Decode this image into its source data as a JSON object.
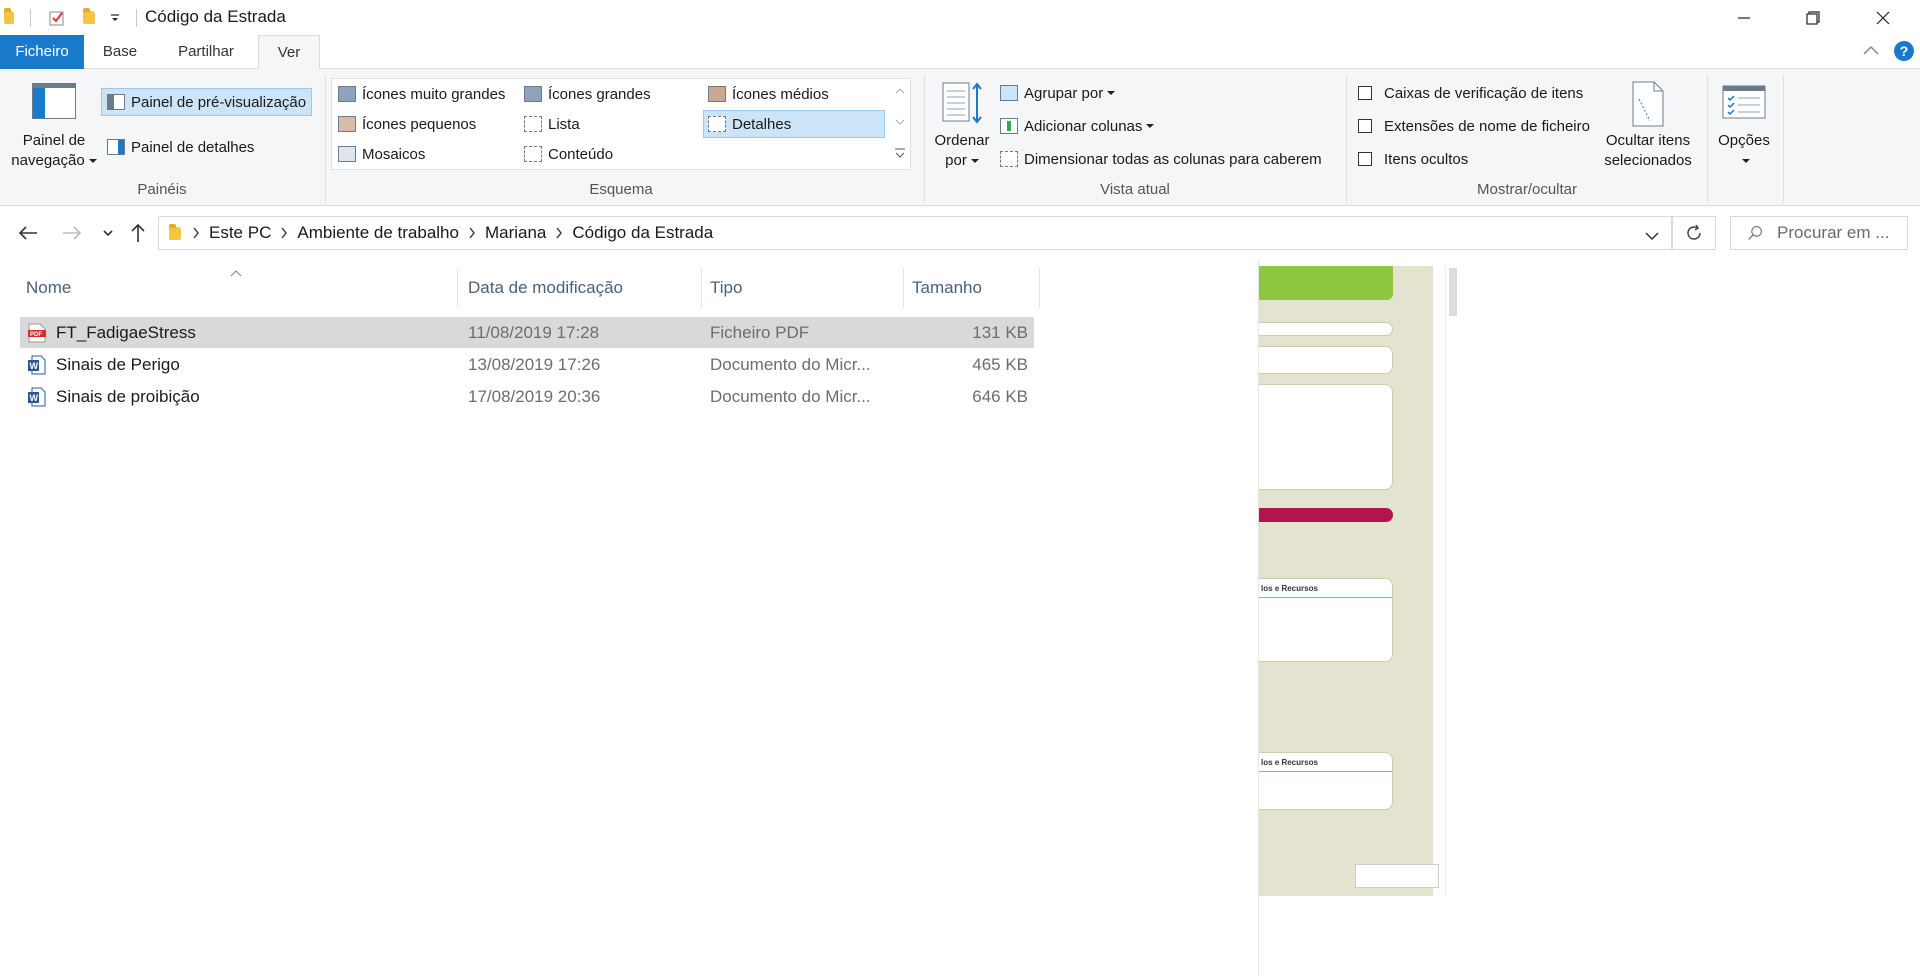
{
  "window": {
    "title": "Código da Estrada",
    "minimize_icon": "minimize-icon",
    "restore_icon": "restore-icon",
    "close_icon": "close-icon"
  },
  "tabs": [
    {
      "label": "Ficheiro"
    },
    {
      "label": "Base"
    },
    {
      "label": "Partilhar"
    },
    {
      "label": "Ver"
    }
  ],
  "ribbon": {
    "paineis": {
      "label": "Painéis",
      "nav_pane_line1": "Painel de",
      "nav_pane_line2": "navegação",
      "preview_pane": "Painel de pré-visualização",
      "details_pane": "Painel de detalhes"
    },
    "esquema": {
      "label": "Esquema",
      "items": [
        {
          "label": "Ícones muito grandes"
        },
        {
          "label": "Ícones grandes"
        },
        {
          "label": "Ícones médios"
        },
        {
          "label": "Ícones pequenos"
        },
        {
          "label": "Lista"
        },
        {
          "label": "Detalhes"
        },
        {
          "label": "Mosaicos"
        },
        {
          "label": "Conteúdo"
        }
      ],
      "selected": "Detalhes"
    },
    "vista_atual": {
      "label": "Vista atual",
      "sort_line1": "Ordenar",
      "sort_line2": "por",
      "group_by": "Agrupar por",
      "add_columns": "Adicionar colunas",
      "fit_columns": "Dimensionar todas as colunas para caberem"
    },
    "mostrar_ocultar": {
      "label": "Mostrar/ocultar",
      "item_checkboxes": "Caixas de verificação de itens",
      "file_extensions": "Extensões de nome de ficheiro",
      "hidden_items": "Itens ocultos",
      "hide_selected_line1": "Ocultar itens",
      "hide_selected_line2": "selecionados"
    },
    "options": "Opções"
  },
  "address": {
    "crumbs": [
      "Este PC",
      "Ambiente de trabalho",
      "Mariana",
      "Código da Estrada"
    ],
    "search_placeholder": "Procurar em ..."
  },
  "columns": {
    "name": "Nome",
    "date": "Data de modificação",
    "type": "Tipo",
    "size": "Tamanho"
  },
  "files": [
    {
      "name": "FT_FadigaeStress",
      "date": "11/08/2019 17:28",
      "type": "Ficheiro PDF",
      "size": "131 KB",
      "icon": "pdf-icon",
      "selected": true
    },
    {
      "name": "Sinais de Perigo",
      "date": "13/08/2019 17:26",
      "type": "Documento do Micr...",
      "size": "465 KB",
      "icon": "word-icon",
      "selected": false
    },
    {
      "name": "Sinais de proibição",
      "date": "17/08/2019 20:36",
      "type": "Documento do Micr...",
      "size": "646 KB",
      "icon": "word-icon",
      "selected": false
    }
  ],
  "preview": {
    "caption1": "los e Recursos",
    "caption2": "los e Recursos",
    "colors": {
      "green": "#8dc63f",
      "red": "#b5134b",
      "bg": "#e3e3cf"
    }
  },
  "colors": {
    "accent": "#1979ca",
    "selection": "#cce4f7"
  }
}
